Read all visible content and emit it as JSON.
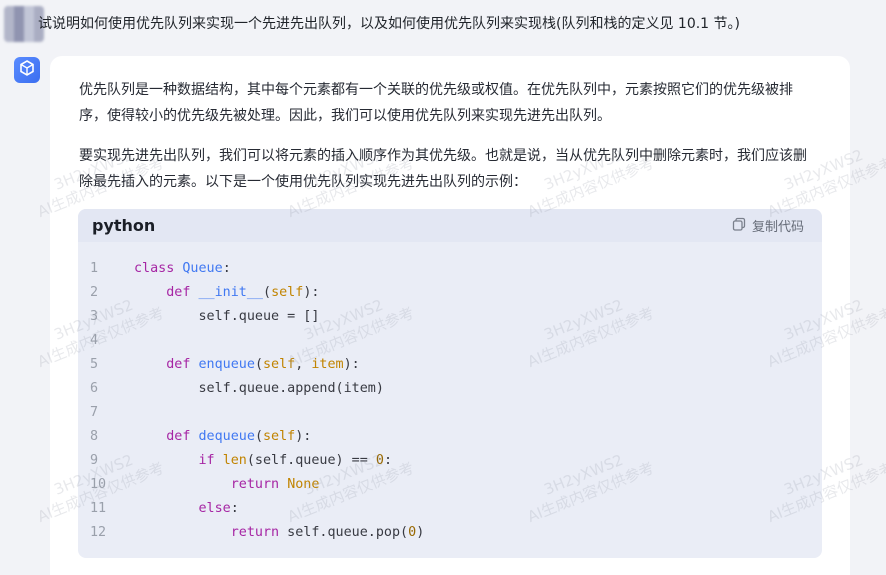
{
  "user": {
    "question": "试说明如何使用优先队列来实现一个先进先出队列，以及如何使用优先队列来实现栈(队列和栈的定义见 10.1 节。)"
  },
  "answer": {
    "para1": "优先队列是一种数据结构，其中每个元素都有一个关联的优先级或权值。在优先队列中，元素按照它们的优先级被排序，使得较小的优先级先被处理。因此，我们可以使用优先队列来实现先进先出队列。",
    "para2": "要实现先进先出队列，我们可以将元素的插入顺序作为其优先级。也就是说，当从优先队列中删除元素时，我们应该删除最先插入的元素。以下是一个使用优先队列实现先进先出队列的示例："
  },
  "code": {
    "language": "python",
    "copy_label": "复制代码",
    "lines": [
      {
        "n": "1",
        "html": "<span class=\"kw\">class</span> <span class=\"fn\">Queue</span>:"
      },
      {
        "n": "2",
        "html": "    <span class=\"kw\">def</span> <span class=\"fn\">__init__</span>(<span class=\"bi\">self</span>):"
      },
      {
        "n": "3",
        "html": "        self.queue = []"
      },
      {
        "n": "4",
        "html": ""
      },
      {
        "n": "5",
        "html": "    <span class=\"kw\">def</span> <span class=\"fn\">enqueue</span>(<span class=\"bi\">self</span>, <span class=\"bi\">item</span>):"
      },
      {
        "n": "6",
        "html": "        self.queue.append(item)"
      },
      {
        "n": "7",
        "html": ""
      },
      {
        "n": "8",
        "html": "    <span class=\"kw\">def</span> <span class=\"fn\">dequeue</span>(<span class=\"bi\">self</span>):"
      },
      {
        "n": "9",
        "html": "        <span class=\"kw\">if</span> <span class=\"bi\">len</span>(self.queue) == <span class=\"num\">0</span>:"
      },
      {
        "n": "10",
        "html": "            <span class=\"kw\">return</span> <span class=\"bi\">None</span>"
      },
      {
        "n": "11",
        "html": "        <span class=\"kw\">else</span>:"
      },
      {
        "n": "12",
        "html": "            <span class=\"kw\">return</span> self.queue.pop(<span class=\"num\">0</span>)"
      }
    ]
  },
  "watermark": {
    "line1": "3H2yXWS2",
    "line2": "AI生成内容仅供参考"
  },
  "colors": {
    "page_bg": "#f2f3f7",
    "card_bg": "#ffffff",
    "code_bg": "#eaedf6",
    "code_header_bg": "#e3e7f3",
    "accent": "#3b6ef0"
  },
  "icons": {
    "bot_avatar": "cube-icon",
    "copy": "copy-icon"
  }
}
